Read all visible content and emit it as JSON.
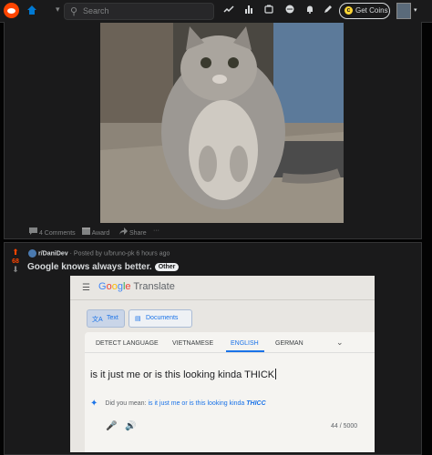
{
  "header": {
    "search_placeholder": "Search",
    "coins_label": "Get Coins"
  },
  "post1": {
    "actions": {
      "comments": "4 Comments",
      "award": "Award",
      "share": "Share",
      "more": "···"
    }
  },
  "post2": {
    "score": "68",
    "subreddit": "r/DaniDev",
    "meta": "· Posted by u/bruno-pk 6 hours ago",
    "title": "Google knows always better.",
    "flair": "Other",
    "translate": {
      "brand_google": [
        "G",
        "o",
        "o",
        "g",
        "l",
        "e"
      ],
      "brand_translate": "Translate",
      "tab_text": "Text",
      "tab_documents": "Documents",
      "languages": [
        "DETECT LANGUAGE",
        "VIETNAMESE",
        "ENGLISH",
        "GERMAN"
      ],
      "input_text": "is it just me or is this looking kinda THICK",
      "did_you_mean_label": "Did you mean:",
      "suggestion": "is it just me or is this looking kinda",
      "suggestion_emphasis": "THICC",
      "char_count": "44 / 5000"
    }
  },
  "colors": {
    "accent_orange": "#ff4500",
    "google_blue": "#1a73e8",
    "coin_gold": "#ffd635"
  },
  "icons": [
    "reddit-logo-icon",
    "home-icon",
    "chevron-down-icon",
    "search-icon",
    "trending-icon",
    "stats-icon",
    "communities-icon",
    "chat-icon",
    "bell-icon",
    "pencil-icon",
    "coin-icon",
    "comment-icon",
    "award-icon",
    "share-icon",
    "upvote-icon",
    "downvote-icon",
    "menu-icon",
    "translate-icon",
    "document-icon",
    "sparkle-icon",
    "mic-icon",
    "speaker-icon"
  ]
}
